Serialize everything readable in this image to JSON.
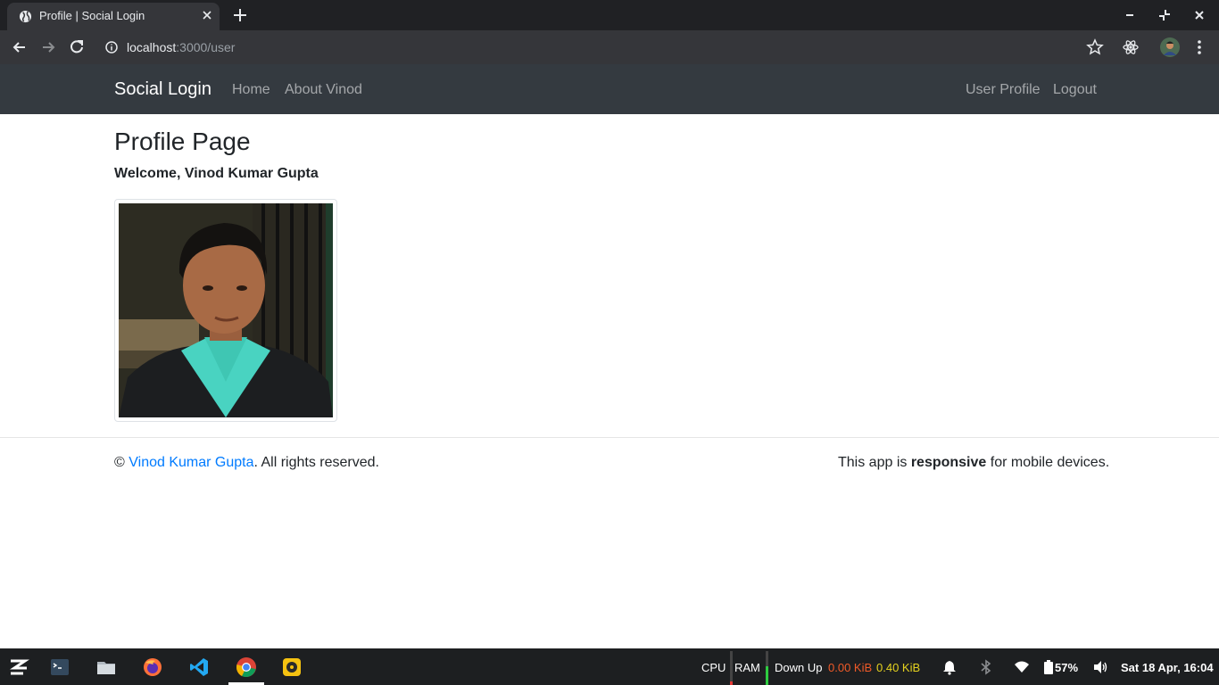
{
  "browser": {
    "tab_title": "Profile | Social Login",
    "url_host": "localhost",
    "url_path": ":3000/user"
  },
  "navbar": {
    "brand": "Social Login",
    "links_left": [
      "Home",
      "About Vinod"
    ],
    "links_right": [
      "User Profile",
      "Logout"
    ]
  },
  "page": {
    "title": "Profile Page",
    "welcome": "Welcome, Vinod Kumar Gupta"
  },
  "footer": {
    "copyright_symbol": "©",
    "author_link": "Vinod Kumar Gupta",
    "rights": ". All rights reserved.",
    "right_pre": "This app is ",
    "right_bold": "responsive",
    "right_post": " for mobile devices."
  },
  "taskbar": {
    "cpu_label": "CPU",
    "ram_label": "RAM",
    "net_label": "Down Up",
    "down_value": "0.00 KiB",
    "up_value": "0.40 KiB",
    "battery": "57%",
    "clock": "Sat 18 Apr, 16:04"
  },
  "colors": {
    "navbar_bg": "#343a40",
    "link_blue": "#007bff",
    "chrome_dark": "#202124"
  }
}
